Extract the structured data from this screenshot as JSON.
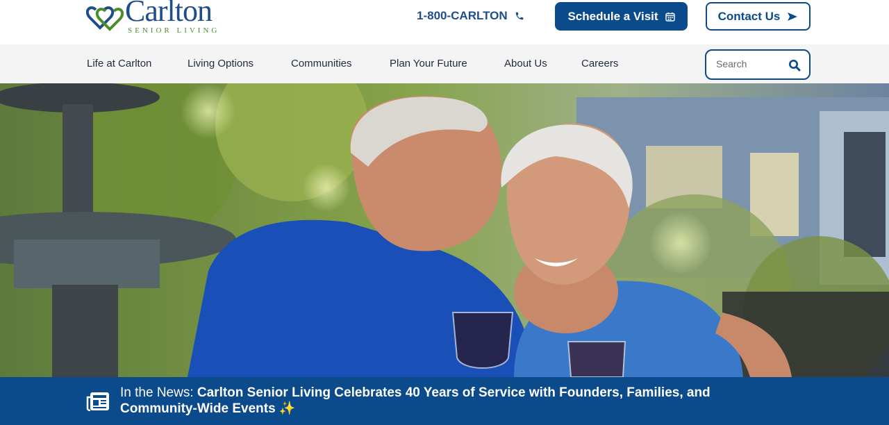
{
  "brand": {
    "name": "Carlton",
    "tagline": "SENIOR LIVING",
    "colors": {
      "primary": "#0b4a8b",
      "accent_green": "#4b8c2a"
    }
  },
  "header": {
    "phone": "1-800-CARLTON",
    "phone_icon": "phone-icon",
    "schedule_label": "Schedule a Visit",
    "schedule_icon": "calendar-icon",
    "contact_label": "Contact Us",
    "contact_icon": "send-arrow-icon"
  },
  "nav": {
    "items": [
      {
        "label": "Life at Carlton"
      },
      {
        "label": "Living Options"
      },
      {
        "label": "Communities"
      },
      {
        "label": "Plan Your Future"
      },
      {
        "label": "About Us"
      },
      {
        "label": "Careers"
      }
    ],
    "search_placeholder": "Search",
    "search_icon": "search-icon"
  },
  "news": {
    "prefix": "In the News:",
    "headline": "Carlton Senior Living Celebrates 40 Years of Service with Founders, Families, and Community-Wide Events",
    "emoji": "✨",
    "icon": "newspaper-icon"
  }
}
